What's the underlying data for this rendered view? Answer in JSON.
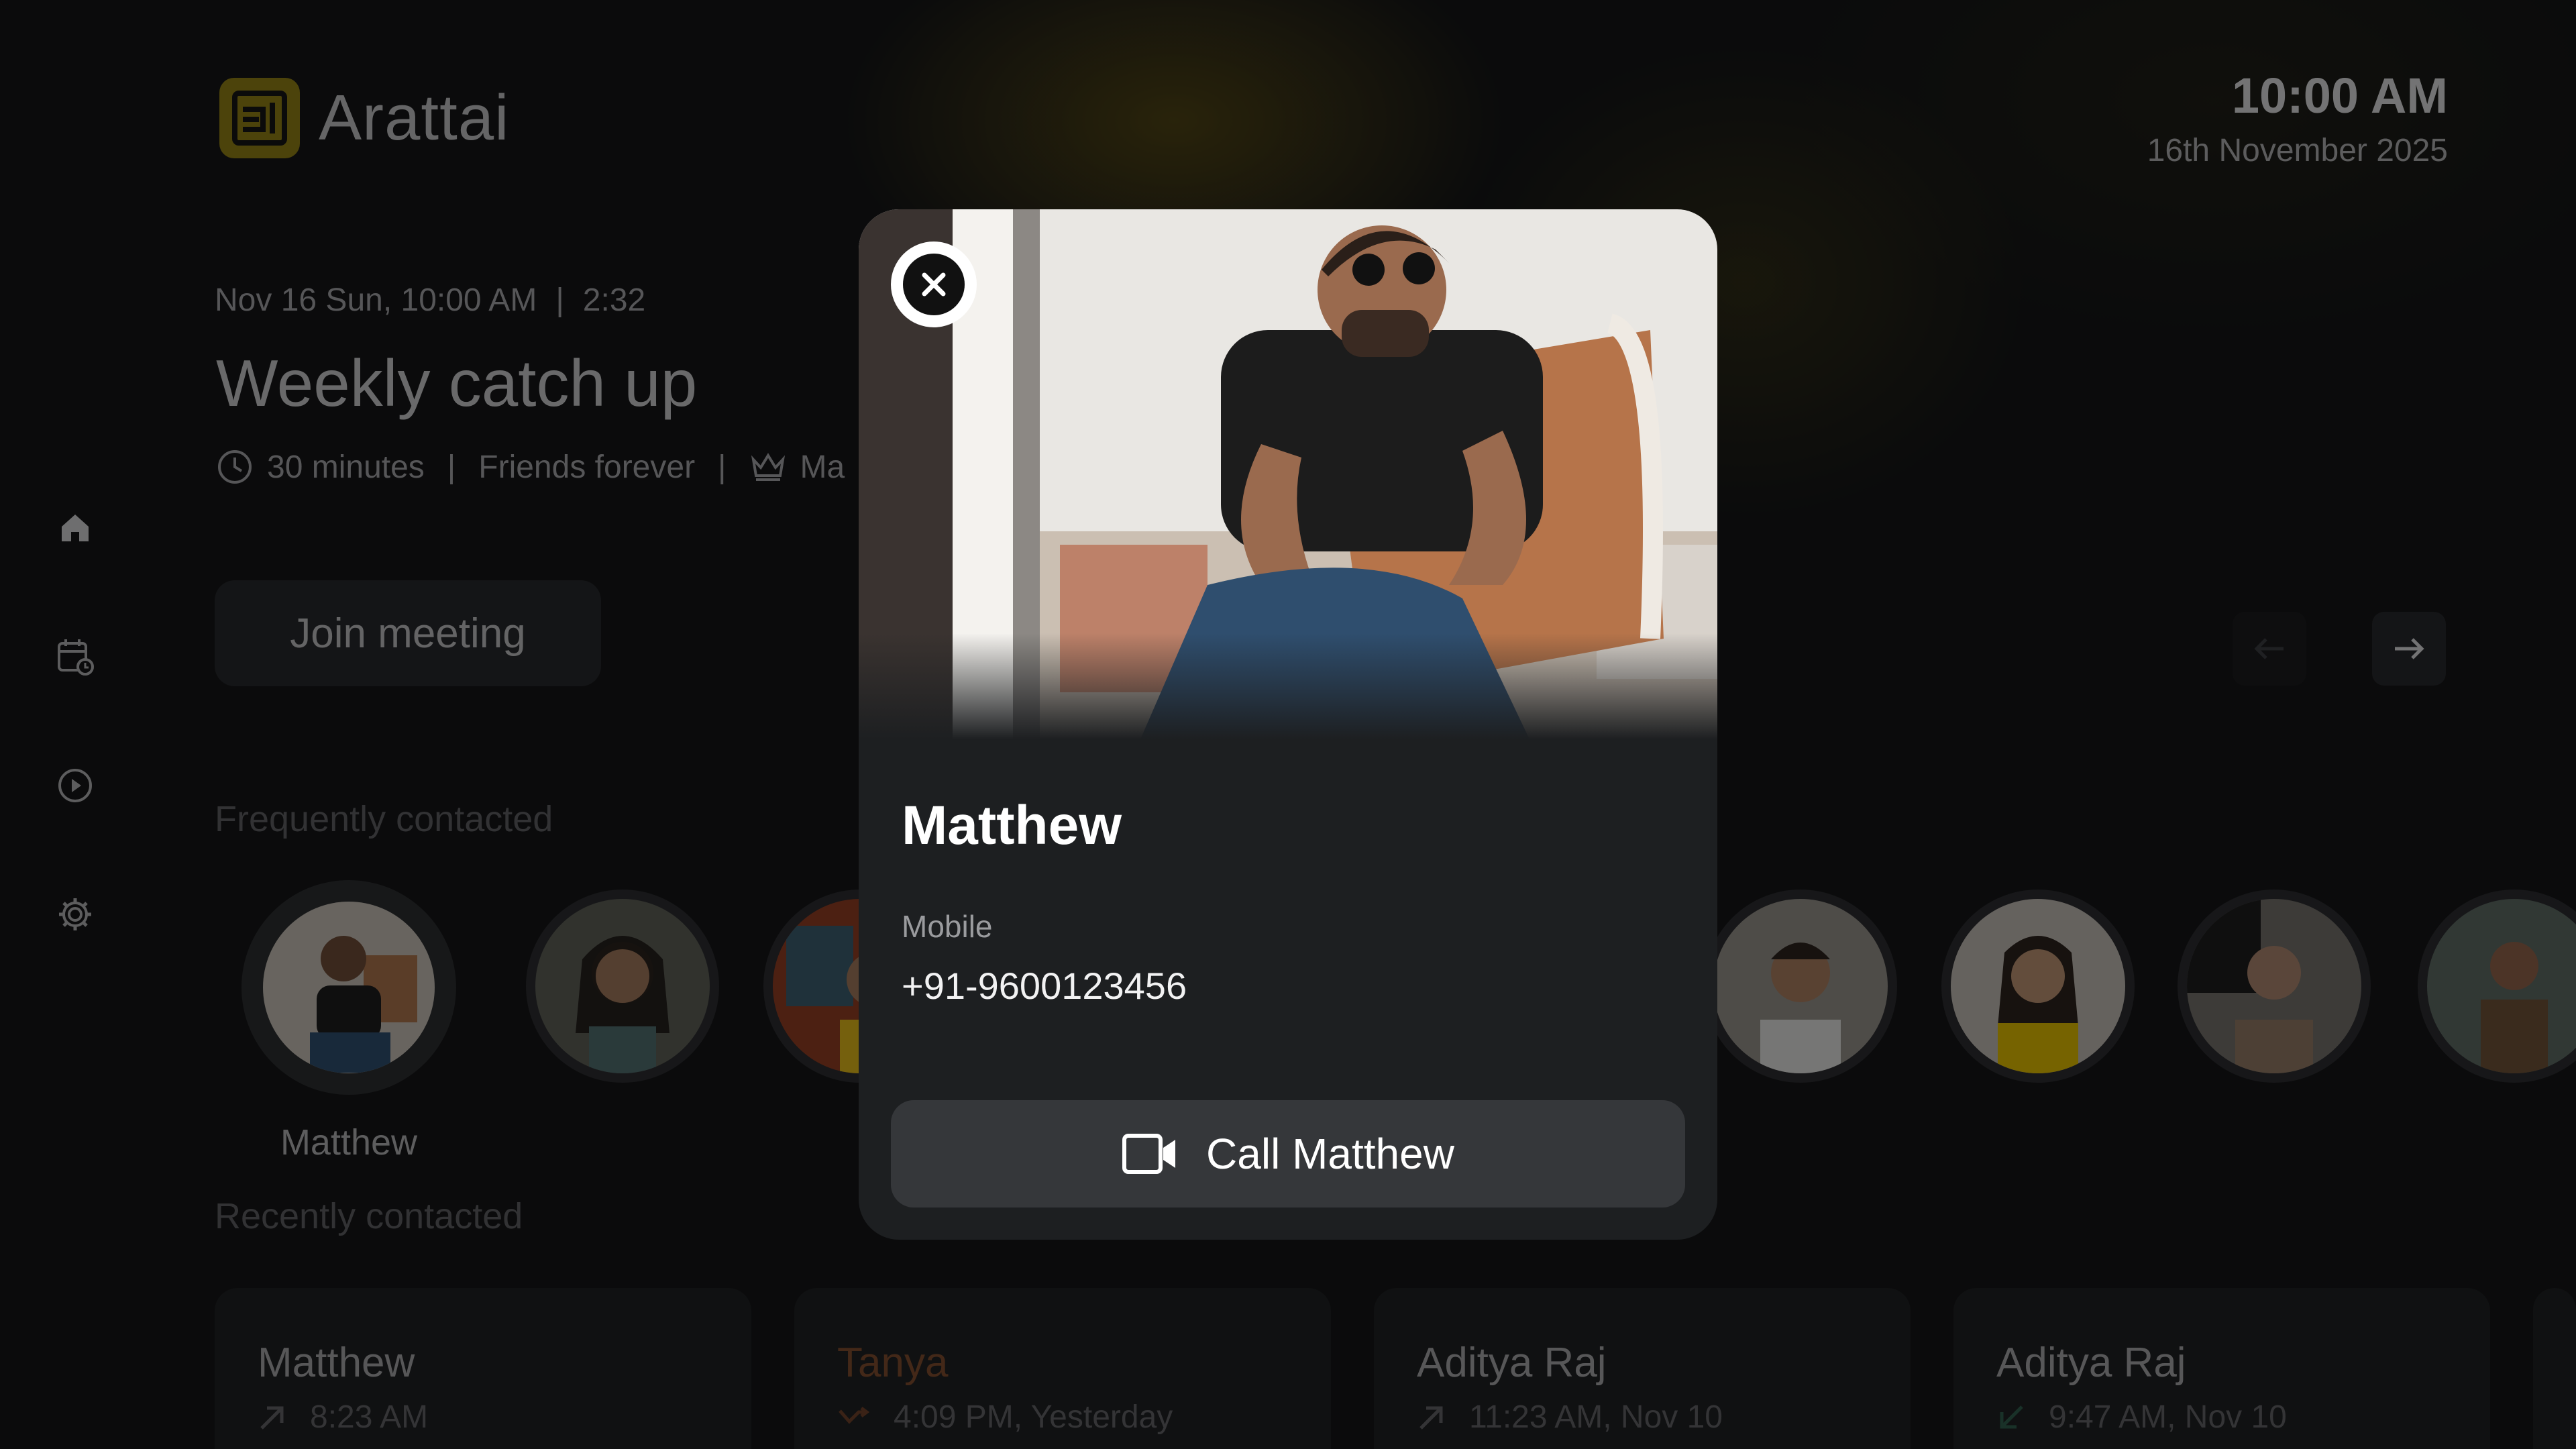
{
  "app": {
    "name": "Arattai"
  },
  "clock": {
    "time": "10:00 AM",
    "date": "16th November 2025"
  },
  "sidebar": {
    "items": [
      "home-icon",
      "calendar-clock-icon",
      "play-circle-icon",
      "settings-icon"
    ]
  },
  "meeting": {
    "datetime": "Nov 16 Sun, 10:00 AM",
    "separator": "|",
    "countdown": "2:32",
    "title": "Weekly catch up",
    "duration": "30 minutes",
    "group": "Friends forever",
    "host_partial": "Ma",
    "join_label": "Join meeting"
  },
  "sections": {
    "frequent": "Frequently contacted",
    "recent": "Recently contacted"
  },
  "frequent": {
    "selected_name": "Matthew"
  },
  "recent": [
    {
      "name": "Matthew",
      "time": "8:23 AM",
      "type": "outgoing"
    },
    {
      "name": "Tanya",
      "time": "4:09 PM, Yesterday",
      "type": "missed"
    },
    {
      "name": "Aditya Raj",
      "time": "11:23 AM, Nov 10",
      "type": "outgoing"
    },
    {
      "name": "Aditya Raj",
      "time": "9:47 AM, Nov 10",
      "type": "incoming"
    }
  ],
  "modal": {
    "name": "Matthew",
    "phone_label": "Mobile",
    "phone": "+91-9600123456",
    "call_label": "Call Matthew"
  },
  "colors": {
    "accent": "#8a7a14",
    "missed": "#7a4a2c",
    "modal_bg": "#1d1f21"
  }
}
